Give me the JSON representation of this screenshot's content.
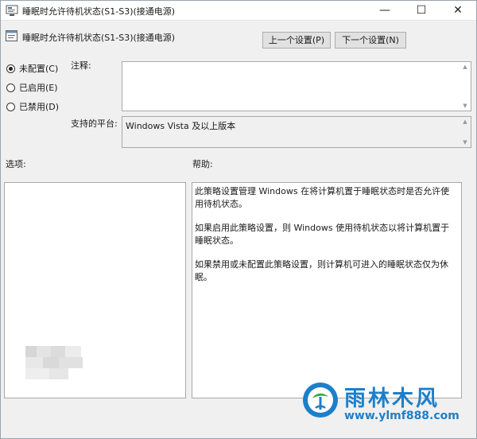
{
  "window": {
    "title": "睡眠时允许待机状态(S1-S3)(接通电源)",
    "controls": {
      "minimize": "—",
      "maximize": "☐",
      "close": "✕"
    }
  },
  "header": {
    "setting_title": "睡眠时允许待机状态(S1-S3)(接通电源)",
    "prev_button": "上一个设置(P)",
    "next_button": "下一个设置(N)"
  },
  "state": {
    "options": [
      {
        "label": "未配置(C)",
        "checked": true
      },
      {
        "label": "已启用(E)",
        "checked": false
      },
      {
        "label": "已禁用(D)",
        "checked": false
      }
    ]
  },
  "comment": {
    "label": "注释:",
    "value": ""
  },
  "platform": {
    "label": "支持的平台:",
    "value": "Windows Vista 及以上版本"
  },
  "options_pane": {
    "label": "选项:"
  },
  "help": {
    "label": "帮助:",
    "paragraphs": [
      "此策略设置管理 Windows 在将计算机置于睡眠状态时是否允许使用待机状态。",
      "如果启用此策略设置，则 Windows 使用待机状态以将计算机置于睡眠状态。",
      "如果禁用或未配置此策略设置，则计算机可进入的睡眠状态仅为休眠。"
    ]
  },
  "watermark": {
    "title": "雨林木风",
    "url": "www.ylmf888.com"
  },
  "colors": {
    "window_bg": "#f0f0f0",
    "button_bg": "#e1e1e1",
    "watermark_blue": "#1d7fc9",
    "watermark_green": "#39a935"
  }
}
